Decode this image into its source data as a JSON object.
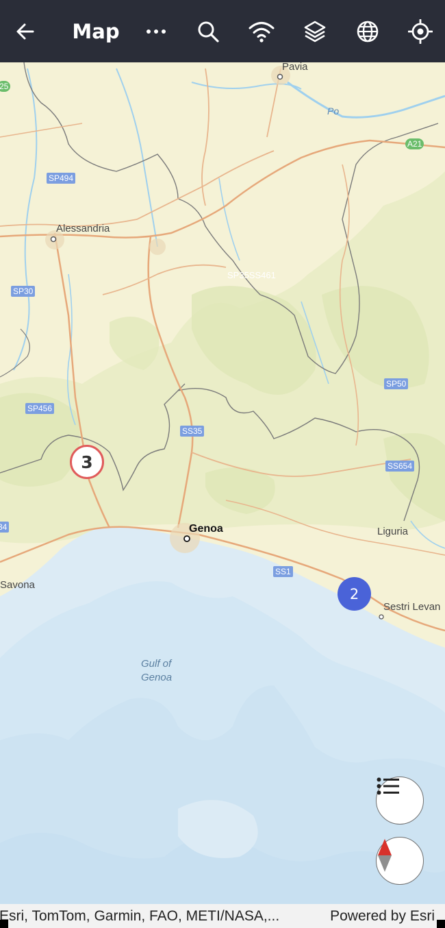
{
  "toolbar": {
    "title": "Map",
    "icons": [
      "back-arrow-icon",
      "more-dots-icon",
      "search-icon",
      "wifi-icon",
      "layers-icon",
      "globe-icon",
      "locate-icon"
    ]
  },
  "map": {
    "places": {
      "pavia": "Pavia",
      "alessandria": "Alessandria",
      "genoa": "Genoa",
      "savona": "Savona",
      "liguria": "Liguria",
      "sestri": "Sestri Levan",
      "gulf_line1": "Gulf of",
      "gulf_line2": "Genoa",
      "po": "Po"
    },
    "road_shields": {
      "a21": "A21",
      "sp494": "SP494",
      "sp30": "SP30",
      "sp456": "SP456",
      "ss35": "SS35",
      "ss461": "SP35SS461",
      "sp50": "SP50",
      "ss654": "SS654",
      "ss1": "SS1",
      "s25": "25",
      "s34": "34"
    },
    "clusters": {
      "red_count": "3",
      "blue_count": "2"
    },
    "colors": {
      "land": "#f5f2d6",
      "sea": "#dcebf5",
      "deep_sea": "#cde3f2",
      "roads": "#e6a87a",
      "rivers": "#9fd0ee",
      "cluster_red": "#e05a5a",
      "cluster_blue": "#4a63d8",
      "toolbar": "#2a2d38"
    }
  },
  "controls": {
    "legend_icon": "list-icon",
    "compass_icon": "compass-icon"
  },
  "attribution": {
    "left": "Esri, TomTom, Garmin, FAO, METI/NASA,...",
    "right": "Powered by Esri"
  }
}
